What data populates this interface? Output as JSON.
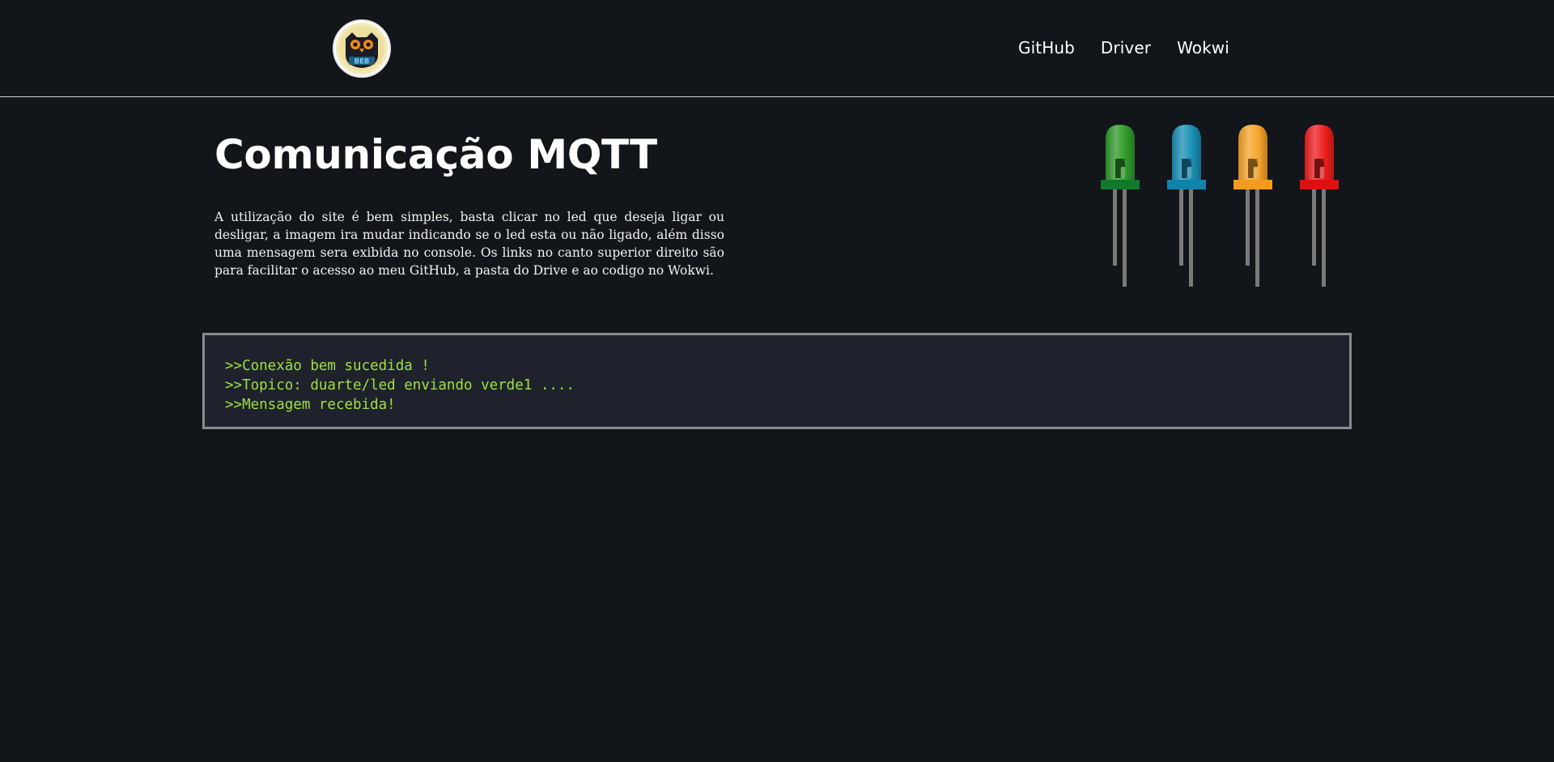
{
  "header": {
    "logo_text": "BEB",
    "nav": [
      {
        "label": "GitHub"
      },
      {
        "label": "Driver"
      },
      {
        "label": "Wokwi"
      }
    ]
  },
  "main": {
    "title": "Comunicação MQTT",
    "description": "A utilização do site é bem simples, basta clicar no led que deseja ligar ou desligar, a imagem ira mudar indicando se o led esta ou não ligado, além disso uma mensagem sera exibida no console. Os links no canto superior direito são para facilitar o acesso ao meu GitHub, a pasta do Drive e ao codigo no Wokwi."
  },
  "leds": [
    {
      "color": "green",
      "body": "#2f9a2a",
      "base": "#0f7a2c"
    },
    {
      "color": "blue",
      "body": "#1a8fb5",
      "base": "#1083aa"
    },
    {
      "color": "orange",
      "body": "#f5a52a",
      "base": "#f39c1c"
    },
    {
      "color": "red",
      "body": "#ee1e1e",
      "base": "#e11010"
    }
  ],
  "console": {
    "lines": [
      ">>Conexão bem sucedida !",
      ">>Topico: duarte/led enviando verde1 ....",
      ">>Mensagem recebida!"
    ]
  },
  "colors": {
    "background": "#121519",
    "console_bg": "#1f222c",
    "console_text": "#9be33c",
    "console_border": "#8a8a8f"
  }
}
